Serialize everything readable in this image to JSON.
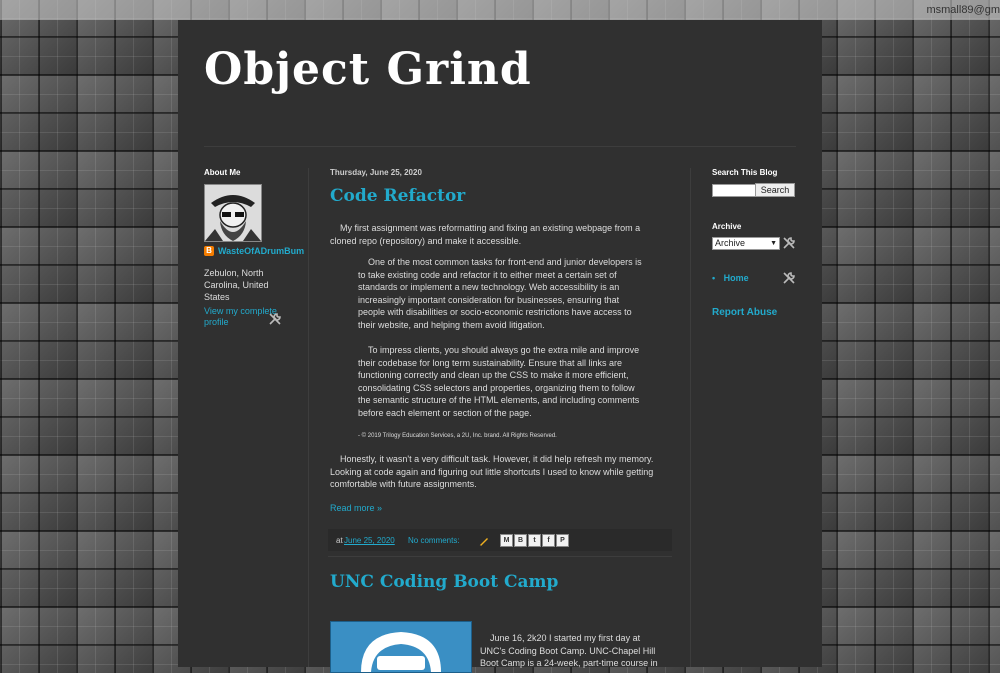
{
  "navbar": {
    "user": "msmall89@gm"
  },
  "header": {
    "title": "Object Grind"
  },
  "about": {
    "title": "About Me",
    "name": "WasteOfADrumBum",
    "location": "Zebulon, North Carolina, United States",
    "profile_link": "View my complete profile"
  },
  "post1": {
    "date_header": "Thursday, June 25, 2020",
    "title": "Code Refactor",
    "intro": "My first assignment was reformatting and fixing an existing webpage from a cloned repo (repository) and make it accessible.",
    "quote1": "One of the most common tasks for front-end and junior developers is to take existing code and refactor it to either meet a certain set of standards or implement a new technology. Web accessibility is an increasingly important consideration for businesses, ensuring that people with disabilities or socio-economic restrictions have access to their website, and helping them avoid litigation.",
    "quote2": "To impress clients, you should always go the extra mile and improve their codebase for long term sustainability. Ensure that all links are functioning correctly and clean up the CSS to make it more efficient, consolidating CSS selectors and properties, organizing them to follow the semantic structure of the HTML elements, and including comments before each element or section of the page.",
    "copyright": "- © 2019 Trilogy Education Services, a 2U, Inc. brand. All Rights Reserved.",
    "closing": "Honestly, it wasn't a very difficult task. However, it did help refresh my memory. Looking at code again and figuring out little shortcuts I used to know while getting comfortable with future assignments.",
    "read_more": "Read more »",
    "at_label": "at",
    "post_date": "June 25, 2020",
    "comments": "No comments:",
    "share_buttons": [
      "M",
      "B",
      "t",
      "f",
      "P"
    ]
  },
  "post2": {
    "title": "UNC Coding Boot Camp",
    "body": "June 16, 2k20 I started my first day at UNC's Coding Boot Camp. UNC-Chapel Hill Boot Camp is a 24-week, part-time course in"
  },
  "search": {
    "title": "Search This Blog",
    "input_value": "",
    "button": "Search"
  },
  "archive": {
    "title": "Archive",
    "selected": "Archive"
  },
  "pages": {
    "item": "Home"
  },
  "report": {
    "label": "Report Abuse"
  },
  "colors": {
    "accent": "#22aacc",
    "panel": "#303030",
    "text": "#dddddd"
  }
}
